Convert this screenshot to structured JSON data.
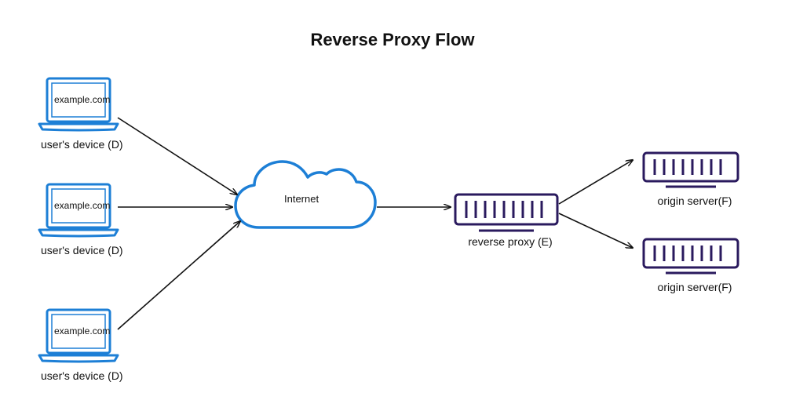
{
  "title": "Reverse Proxy Flow",
  "nodes": {
    "device1": {
      "screen_text": "example.com",
      "label": "user's device (D)"
    },
    "device2": {
      "screen_text": "example.com",
      "label": "user's device (D)"
    },
    "device3": {
      "screen_text": "example.com",
      "label": "user's device (D)"
    },
    "internet": {
      "label": "Internet"
    },
    "reverse_proxy": {
      "label": "reverse proxy (E)"
    },
    "origin1": {
      "label": "origin server(F)"
    },
    "origin2": {
      "label": "origin server(F)"
    }
  },
  "colors": {
    "device_stroke": "#1d7fd6",
    "cloud_stroke": "#1d7fd6",
    "server_stroke": "#2a1a5e",
    "arrow": "#111111"
  }
}
